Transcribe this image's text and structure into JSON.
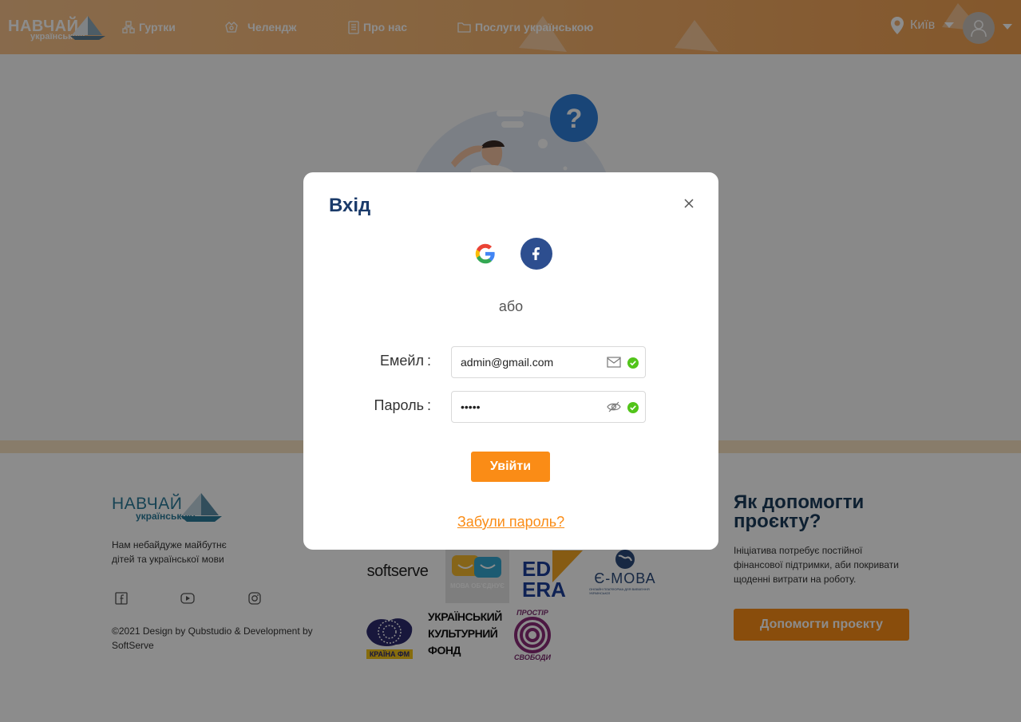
{
  "header": {
    "logo_big": "НАВЧАЙ",
    "logo_small": "українською",
    "nav": [
      {
        "label": "Гуртки",
        "icon": "clubs-icon"
      },
      {
        "label": "Челендж",
        "icon": "challenge-icon"
      },
      {
        "label": "Про нас",
        "icon": "about-icon"
      },
      {
        "label": "Послуги українською",
        "icon": "folder-icon"
      }
    ],
    "city": "Київ"
  },
  "footer": {
    "logo_big": "НАВЧАЙ",
    "logo_small": "українською",
    "description": "Нам небайдуже майбутнє дітей та української мови",
    "copyright": "©2021 Design by Qubstudio & Development by SoftServe",
    "partners": {
      "softserve": "softserve",
      "mova": "МОВА ОБ'ЄДНУЄ",
      "ed": "ED",
      "era": "ERA",
      "emova": "Є-МОВА",
      "emova_sub": "ОНЛАЙН ПЛАТФОРМА ДЛЯ ВИВЧЕННЯ УКРАЇНСЬКОЇ",
      "krayina": "КРАЇНА ФМ",
      "ukf1": "УКРАЇНСЬКИЙ",
      "ukf2": "КУЛЬТУРНИЙ",
      "ukf3": "ФОНД",
      "prostir1": "ПРОСТІР",
      "prostir2": "СВОБОДИ"
    },
    "help_title": "Як допомогти проєкту?",
    "help_desc": "Ініціатива потребує постійної фінансової підтримки, аби покривати щоденні витрати на роботу.",
    "help_button": "Допомогти проєкту"
  },
  "modal": {
    "title": "Вхід",
    "or": "або",
    "email_label": "Емейл",
    "email_value": "admin@gmail.com",
    "password_label": "Пароль",
    "password_value": "•••••",
    "login_button": "Увійти",
    "forgot": "Забули пароль?"
  },
  "colors": {
    "accent": "#fa8c16",
    "title": "#1b3b6a",
    "success": "#52c41a",
    "facebook": "#2d4e8f"
  }
}
